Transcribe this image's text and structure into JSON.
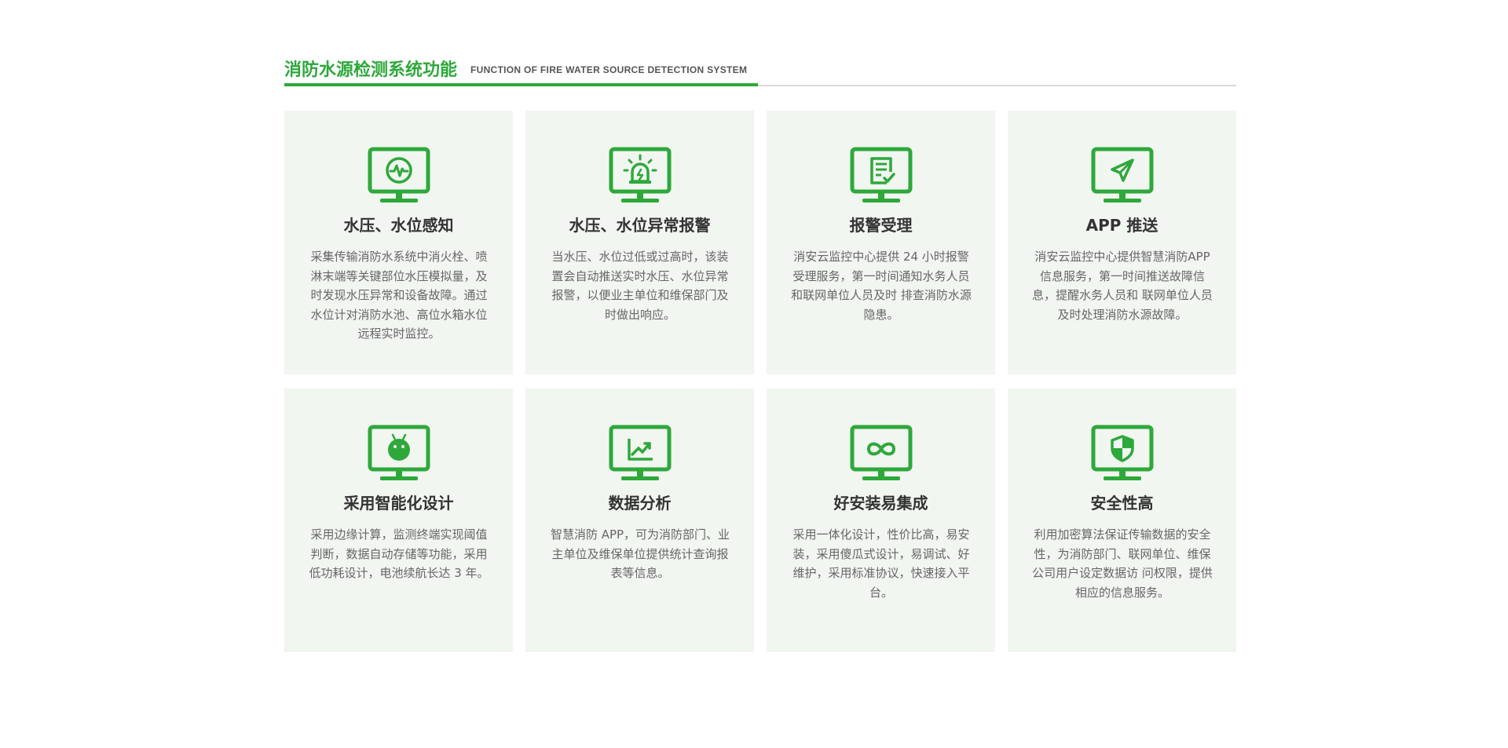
{
  "section": {
    "title_cn": "消防水源检测系统功能",
    "title_en": "FUNCTION OF FIRE WATER SOURCE DETECTION SYSTEM"
  },
  "colors": {
    "accent": "#2ea83b",
    "card_bg": "#f1f6f0",
    "title_text": "#333333",
    "desc_text": "#666666"
  },
  "cards": [
    {
      "icon": "pulse-monitor-icon",
      "title": "水压、水位感知",
      "desc": "采集传输消防水系统中消火栓、喷淋末端等关键部位水压模拟量，及时发现水压异常和设备故障。通过水位计对消防水池、高位水箱水位远程实时监控。"
    },
    {
      "icon": "alarm-light-monitor-icon",
      "title": "水压、水位异常报警",
      "desc": "当水压、水位过低或过高时，该装置会自动推送实时水压、水位异常报警，以便业主单位和维保部门及时做出响应。"
    },
    {
      "icon": "checklist-monitor-icon",
      "title": "报警受理",
      "desc": "消安云监控中心提供 24 小时报警受理服务，第一时间通知水务人员和联网单位人员及时 排查消防水源隐患。"
    },
    {
      "icon": "paper-plane-monitor-icon",
      "title": "APP 推送",
      "desc": "消安云监控中心提供智慧消防APP 信息服务，第一时间推送故障信息，提醒水务人员和 联网单位人员及时处理消防水源故障。"
    },
    {
      "icon": "android-monitor-icon",
      "title": "采用智能化设计",
      "desc": "采用边缘计算，监测终端实现阈值判断，数据自动存储等功能，采用低功耗设计，电池续航长达 3 年。"
    },
    {
      "icon": "chart-monitor-icon",
      "title": "数据分析",
      "desc": "智慧消防 APP，可为消防部门、业主单位及维保单位提供统计查询报表等信息。"
    },
    {
      "icon": "infinity-monitor-icon",
      "title": "好安装易集成",
      "desc": "采用一体化设计，性价比高，易安装，采用傻瓜式设计，易调试、好维护，采用标准协议，快速接入平台。"
    },
    {
      "icon": "shield-monitor-icon",
      "title": "安全性高",
      "desc": "利用加密算法保证传输数据的安全性，为消防部门、联网单位、维保公司用户设定数据访 问权限，提供相应的信息服务。"
    }
  ]
}
